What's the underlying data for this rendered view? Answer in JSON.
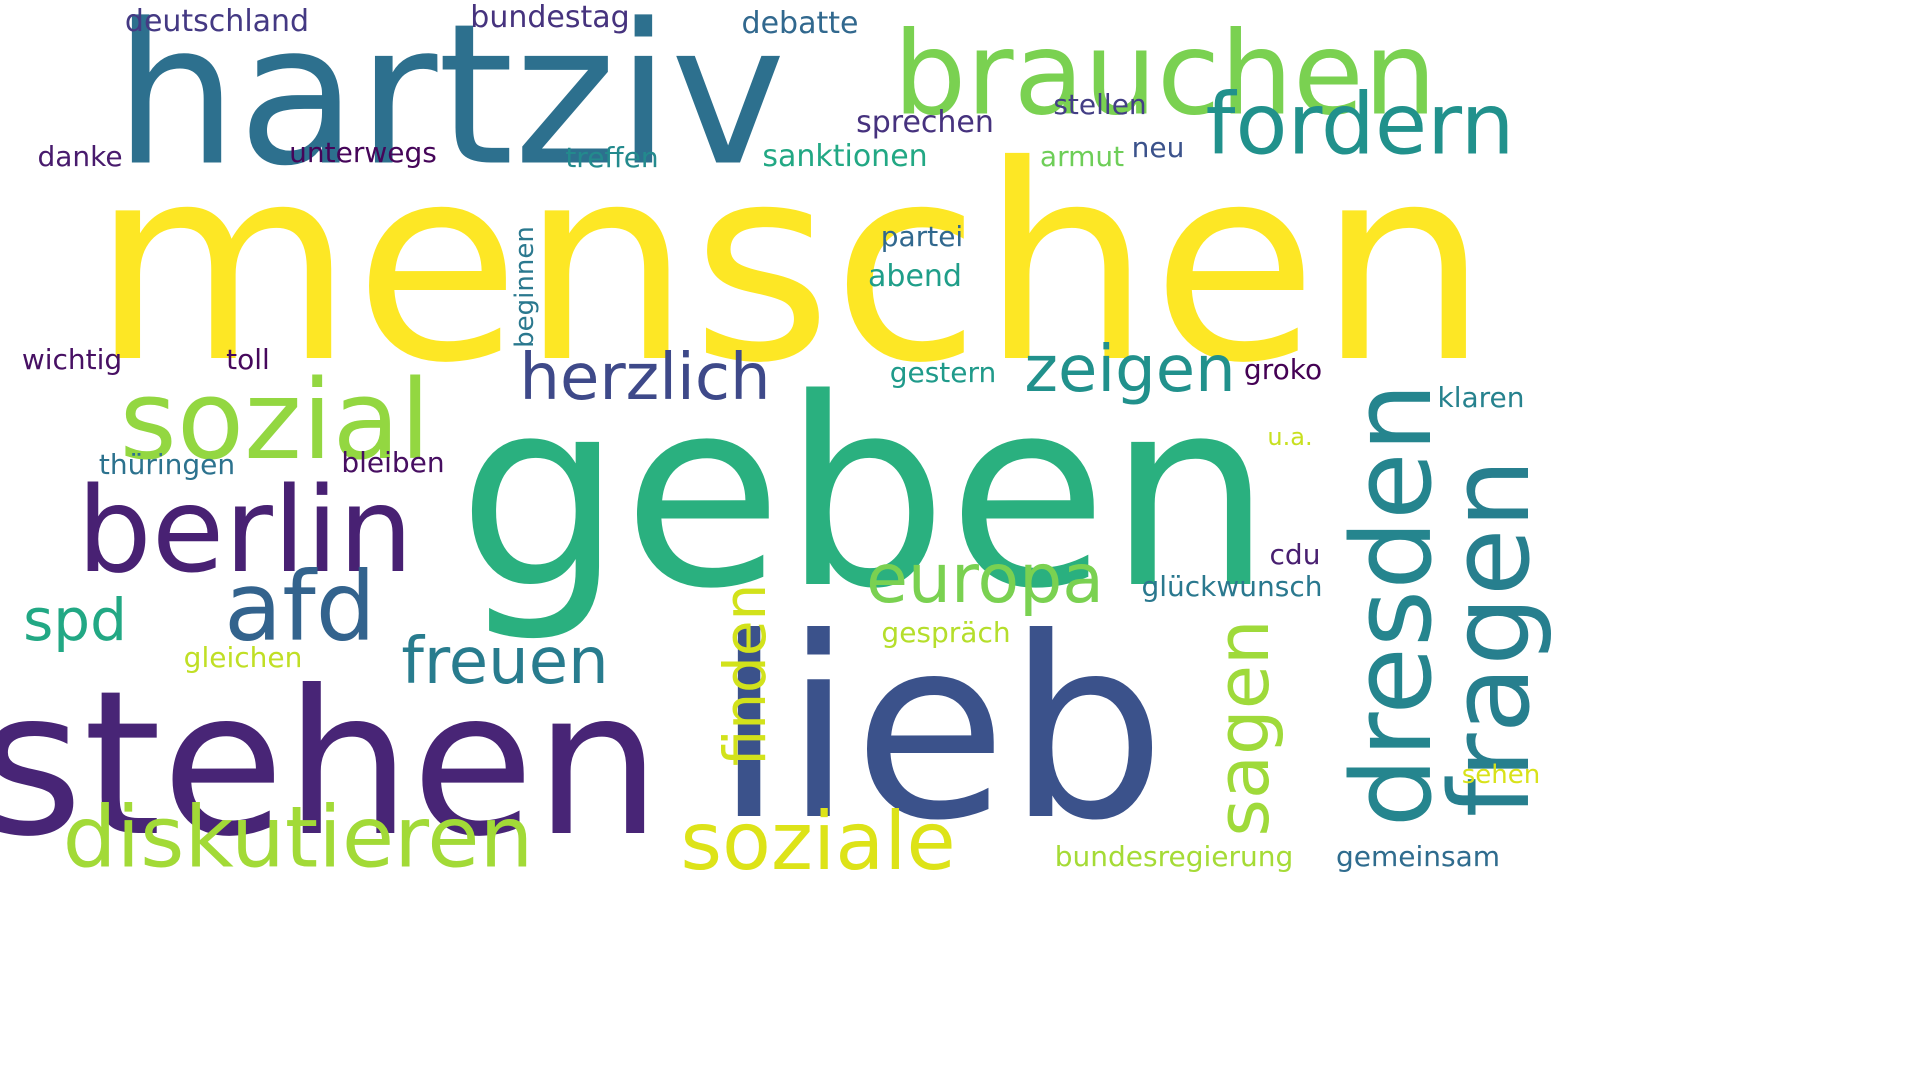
{
  "words": [
    {
      "key": "menschen",
      "text": "menschen",
      "color": "#fde725"
    },
    {
      "key": "geben",
      "text": "geben",
      "color": "#2ab07f"
    },
    {
      "key": "lieb",
      "text": "lieb",
      "color": "#3b528b"
    },
    {
      "key": "stehen",
      "text": "stehen",
      "color": "#482576"
    },
    {
      "key": "hartziv",
      "text": "hartziv",
      "color": "#2d708e"
    },
    {
      "key": "brauchen",
      "text": "brauchen",
      "color": "#7ad151"
    },
    {
      "key": "berlin",
      "text": "berlin",
      "color": "#482173"
    },
    {
      "key": "sozial",
      "text": "sozial",
      "color": "#93d741"
    },
    {
      "key": "dresden",
      "text": "dresden",
      "color": "#25858e"
    },
    {
      "key": "fragen",
      "text": "fragen",
      "color": "#277f8e"
    },
    {
      "key": "fordern",
      "text": "fordern",
      "color": "#21918c"
    },
    {
      "key": "diskutieren",
      "text": "diskutieren",
      "color": "#a2da37"
    },
    {
      "key": "soziale",
      "text": "soziale",
      "color": "#dde318"
    },
    {
      "key": "afd",
      "text": "afd",
      "color": "#33638d"
    },
    {
      "key": "europa",
      "text": "europa",
      "color": "#7ad151"
    },
    {
      "key": "herzlich",
      "text": "herzlich",
      "color": "#3e4989"
    },
    {
      "key": "zeigen",
      "text": "zeigen",
      "color": "#21918c"
    },
    {
      "key": "sagen",
      "text": "sagen",
      "color": "#9fda3a"
    },
    {
      "key": "freuen",
      "text": "freuen",
      "color": "#287c8e"
    },
    {
      "key": "finden",
      "text": "finden",
      "color": "#d2e21b"
    },
    {
      "key": "spd",
      "text": "spd",
      "color": "#22a884"
    },
    {
      "key": "deutschland",
      "text": "deutschland",
      "color": "#443983"
    },
    {
      "key": "bundestag",
      "text": "bundestag",
      "color": "#46337e"
    },
    {
      "key": "debatte",
      "text": "debatte",
      "color": "#31688e"
    },
    {
      "key": "sprechen",
      "text": "sprechen",
      "color": "#46327e"
    },
    {
      "key": "stellen",
      "text": "stellen",
      "color": "#433e85"
    },
    {
      "key": "danke",
      "text": "danke",
      "color": "#481b6d"
    },
    {
      "key": "unterwegs",
      "text": "unterwegs",
      "color": "#450559"
    },
    {
      "key": "treffen",
      "text": "treffen",
      "color": "#238a8d"
    },
    {
      "key": "sanktionen",
      "text": "sanktionen",
      "color": "#22a884"
    },
    {
      "key": "armut",
      "text": "armut",
      "color": "#6ece58"
    },
    {
      "key": "neu",
      "text": "neu",
      "color": "#3b528b"
    },
    {
      "key": "partei",
      "text": "partei",
      "color": "#31688e"
    },
    {
      "key": "abend",
      "text": "abend",
      "color": "#1f9e89"
    },
    {
      "key": "beginnen",
      "text": "beginnen",
      "color": "#2a788e"
    },
    {
      "key": "wichtig",
      "text": "wichtig",
      "color": "#471063"
    },
    {
      "key": "toll",
      "text": "toll",
      "color": "#46085c"
    },
    {
      "key": "gestern",
      "text": "gestern",
      "color": "#1f9a8a"
    },
    {
      "key": "groko",
      "text": "groko",
      "color": "#440154"
    },
    {
      "key": "klaren",
      "text": "klaren",
      "color": "#26828e"
    },
    {
      "key": "ua",
      "text": "u.a.",
      "color": "#c8e020"
    },
    {
      "key": "thueringen",
      "text": "thüringen",
      "color": "#2c728e"
    },
    {
      "key": "bleiben",
      "text": "bleiben",
      "color": "#470e61"
    },
    {
      "key": "cdu",
      "text": "cdu",
      "color": "#481f70"
    },
    {
      "key": "glueckwunsch",
      "text": "glückwunsch",
      "color": "#2a788e"
    },
    {
      "key": "gespraech",
      "text": "gespräch",
      "color": "#b5de2b"
    },
    {
      "key": "gleichen",
      "text": "gleichen",
      "color": "#c0df25"
    },
    {
      "key": "sehen",
      "text": "sehen",
      "color": "#d8e219"
    },
    {
      "key": "bundesregierung",
      "text": "bundesregierung",
      "color": "#a5db36"
    },
    {
      "key": "gemeinsam",
      "text": "gemeinsam",
      "color": "#2f6c8e"
    }
  ]
}
